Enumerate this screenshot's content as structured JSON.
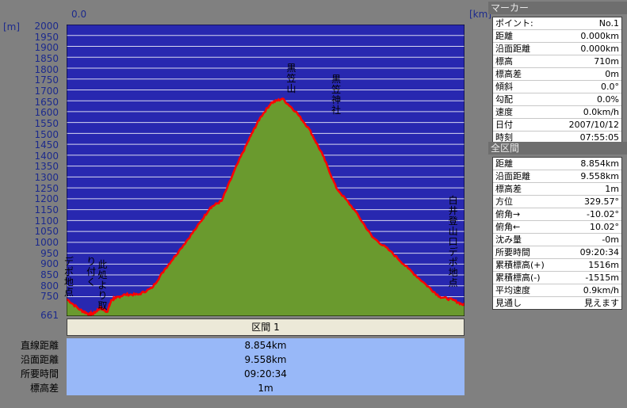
{
  "top_axis": {
    "x_start": "0.0",
    "x_unit": "[km]",
    "y_unit": "[m]"
  },
  "y_ticks": [
    "2000",
    "1950",
    "1900",
    "1850",
    "1800",
    "1750",
    "1700",
    "1650",
    "1600",
    "1550",
    "1500",
    "1450",
    "1400",
    "1350",
    "1300",
    "1250",
    "1200",
    "1150",
    "1100",
    "1050",
    "1000",
    "950",
    "900",
    "850",
    "800",
    "750",
    "661"
  ],
  "chart_data": {
    "type": "area",
    "title": "",
    "xlabel": "[km]",
    "ylabel": "[m]",
    "xlim": [
      0.0,
      8.854
    ],
    "ylim": [
      661,
      2000
    ],
    "x": [
      0.0,
      0.3,
      0.5,
      0.6,
      0.75,
      0.9,
      1.0,
      1.1,
      1.3,
      1.6,
      1.9,
      2.2,
      2.5,
      2.9,
      3.2,
      3.45,
      3.8,
      4.1,
      4.3,
      4.55,
      4.8,
      5.1,
      5.4,
      5.7,
      6.0,
      6.4,
      6.8,
      7.2,
      7.6,
      8.0,
      8.3,
      8.6,
      8.854
    ],
    "values": [
      740,
      690,
      670,
      672,
      700,
      680,
      735,
      745,
      760,
      760,
      790,
      880,
      960,
      1070,
      1160,
      1190,
      1360,
      1490,
      1570,
      1640,
      1660,
      1600,
      1520,
      1400,
      1250,
      1150,
      1025,
      960,
      880,
      805,
      750,
      735,
      710
    ],
    "series": [
      {
        "name": "",
        "color": "#ff0000",
        "fill": "#6a9a2e"
      }
    ],
    "annotations": [
      {
        "text": "デポ地点",
        "x": 0.05,
        "y_top": 935
      },
      {
        "text": "り付く",
        "x": 0.55,
        "y_top": 935
      },
      {
        "text": "此処より取",
        "x": 0.8,
        "y_top": 920
      },
      {
        "text": "黒笠山",
        "x": 5.0,
        "y_top": 1822
      },
      {
        "text": "黒笠神社",
        "x": 6.0,
        "y_top": 1772
      },
      {
        "text": "白井登山口デポ地点",
        "x": 8.6,
        "y_top": 1215
      }
    ],
    "grid": true
  },
  "section_bar": {
    "label": "区間 1"
  },
  "summary_rows": [
    {
      "label": "直線距離",
      "value": "8.854km"
    },
    {
      "label": "沿面距離",
      "value": "9.558km"
    },
    {
      "label": "所要時間",
      "value": "09:20:34"
    },
    {
      "label": "標高差",
      "value": "1m"
    }
  ],
  "marker_panel": {
    "title": "マーカー",
    "rows": [
      {
        "k": "ポイント:",
        "v": "No.1"
      },
      {
        "k": "距離",
        "v": "0.000km"
      },
      {
        "k": "沿面距離",
        "v": "0.000km"
      },
      {
        "k": "標高",
        "v": "710m"
      },
      {
        "k": "標高差",
        "v": "0m"
      },
      {
        "k": "傾斜",
        "v": "0.0°"
      },
      {
        "k": "勾配",
        "v": "0.0%"
      },
      {
        "k": "速度",
        "v": "0.0km/h"
      },
      {
        "k": "日付",
        "v": "2007/10/12"
      },
      {
        "k": "時刻",
        "v": "07:55:05"
      }
    ]
  },
  "section_panel": {
    "title": "全区間",
    "rows": [
      {
        "k": "距離",
        "v": "8.854km"
      },
      {
        "k": "沿面距離",
        "v": "9.558km"
      },
      {
        "k": "標高差",
        "v": "1m"
      },
      {
        "k": "方位",
        "v": "329.57°"
      },
      {
        "k": "俯角→",
        "v": "-10.02°"
      },
      {
        "k": "俯角←",
        "v": "10.02°"
      },
      {
        "k": "沈み量",
        "v": "-0m"
      },
      {
        "k": "所要時間",
        "v": "09:20:34"
      },
      {
        "k": "累積標高(+)",
        "v": "1516m"
      },
      {
        "k": "累積標高(-)",
        "v": "-1515m"
      },
      {
        "k": "平均速度",
        "v": "0.9km/h"
      },
      {
        "k": "見通し",
        "v": "見えます"
      }
    ]
  }
}
